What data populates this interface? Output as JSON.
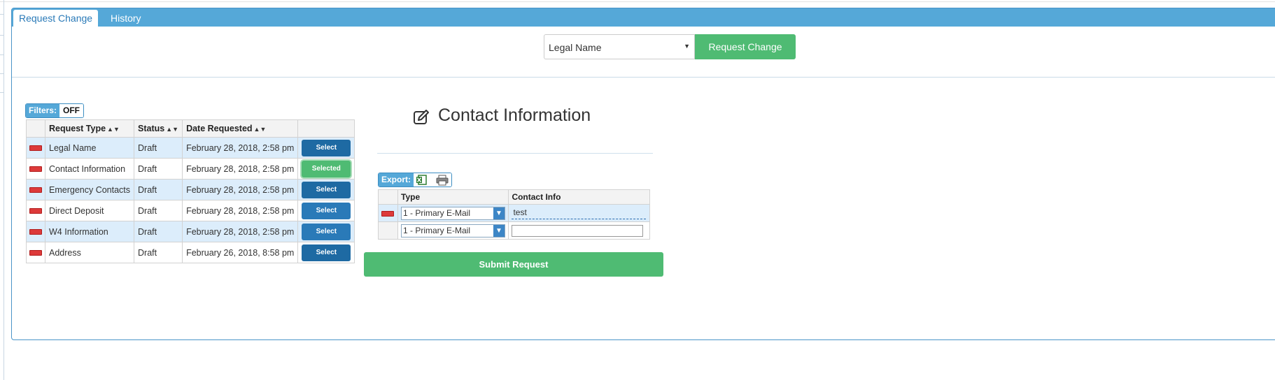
{
  "tabs": [
    {
      "label": "Request Change",
      "active": true
    },
    {
      "label": "History",
      "active": false
    }
  ],
  "change_type": {
    "selected": "Legal Name",
    "button_label": "Request Change"
  },
  "filters": {
    "label": "Filters:",
    "value": "OFF"
  },
  "requests_table": {
    "headers": [
      "Request Type",
      "Status",
      "Date Requested"
    ],
    "rows": [
      {
        "type": "Legal Name",
        "status": "Draft",
        "date": "February 28, 2018, 2:58 pm",
        "action": "Select"
      },
      {
        "type": "Contact Information",
        "status": "Draft",
        "date": "February 28, 2018, 2:58 pm",
        "action": "Selected"
      },
      {
        "type": "Emergency Contacts",
        "status": "Draft",
        "date": "February 28, 2018, 2:58 pm",
        "action": "Select"
      },
      {
        "type": "Direct Deposit",
        "status": "Draft",
        "date": "February 28, 2018, 2:58 pm",
        "action": "Select"
      },
      {
        "type": "W4 Information",
        "status": "Draft",
        "date": "February 28, 2018, 2:58 pm",
        "action": "Select"
      },
      {
        "type": "Address",
        "status": "Draft",
        "date": "February 26, 2018, 8:58 pm",
        "action": "Select"
      }
    ]
  },
  "section": {
    "title": "Contact Information"
  },
  "export": {
    "label": "Export:",
    "icons": [
      "excel-icon",
      "print-icon"
    ]
  },
  "contact_table": {
    "headers": [
      "Type",
      "Contact Info"
    ],
    "rows": [
      {
        "type": "1 - Primary E-Mail",
        "value": "test"
      },
      {
        "type": "1 - Primary E-Mail",
        "value": ""
      }
    ]
  },
  "submit_label": "Submit Request",
  "colors": {
    "tab_bar": "#55a8d8",
    "primary_button": "#2a7ab8",
    "success_button": "#4fbb73",
    "remove": "#dd3a3a",
    "row_highlight": "#dcedfb"
  }
}
